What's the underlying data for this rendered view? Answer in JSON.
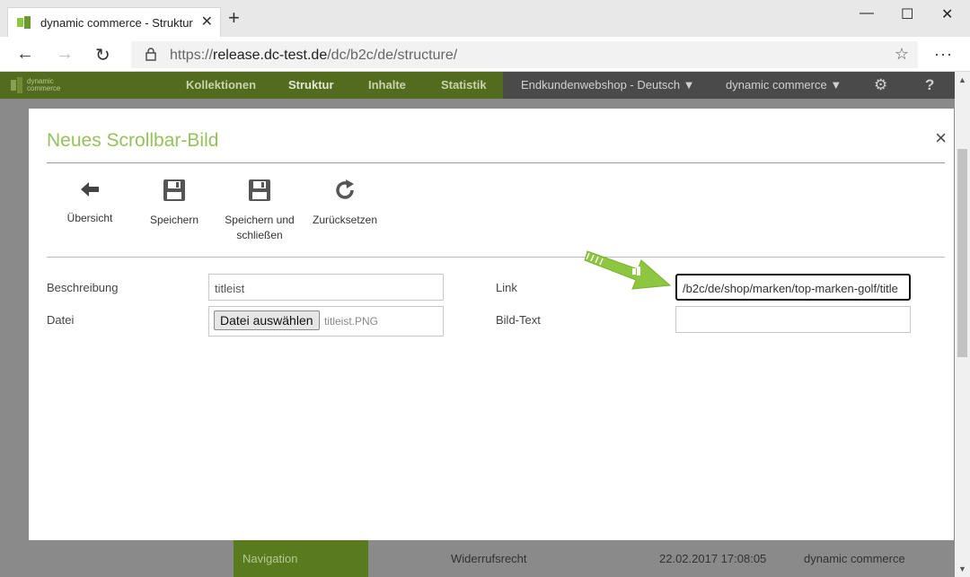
{
  "browser": {
    "tab_title": "dynamic commerce - Struktur",
    "new_tab": "+",
    "tab_close": "✕",
    "url_prefix": "https://",
    "url_host": "release.dc-test.de",
    "url_path": "/dc/b2c/de/structure/"
  },
  "app": {
    "logo_line1": "dynamic",
    "logo_line2": "commerce",
    "nav": [
      "Kollektionen",
      "Struktur",
      "Inhalte",
      "Statistik"
    ],
    "shop_select": "Endkundenwebshop - Deutsch",
    "user_select": "dynamic commerce",
    "help": "?",
    "bottom_row": {
      "nav_label": "Navigation",
      "name": "Widerrufsrecht",
      "date": "22.02.2017 17:08:05",
      "user": "dynamic commerce"
    }
  },
  "modal": {
    "title": "Neues Scrollbar-Bild",
    "close": "×",
    "toolbar": [
      {
        "label": "Übersicht",
        "icon": "arrow-left-icon"
      },
      {
        "label": "Speichern",
        "icon": "save-icon"
      },
      {
        "label": "Speichern und schließen",
        "icon": "save-close-icon"
      },
      {
        "label": "Zurücksetzen",
        "icon": "reset-icon"
      }
    ],
    "form": {
      "beschreibung_label": "Beschreibung",
      "beschreibung_value": "titleist",
      "datei_label": "Datei",
      "datei_button": "Datei auswählen",
      "datei_value": "titleist.PNG",
      "link_label": "Link",
      "link_value": "/b2c/de/shop/marken/top-marken-golf/title",
      "bildtext_label": "Bild-Text",
      "bildtext_value": ""
    }
  },
  "colors": {
    "accent_green": "#97c15e",
    "nav_green": "#536b1f",
    "arrow_green": "#8dc63f"
  }
}
